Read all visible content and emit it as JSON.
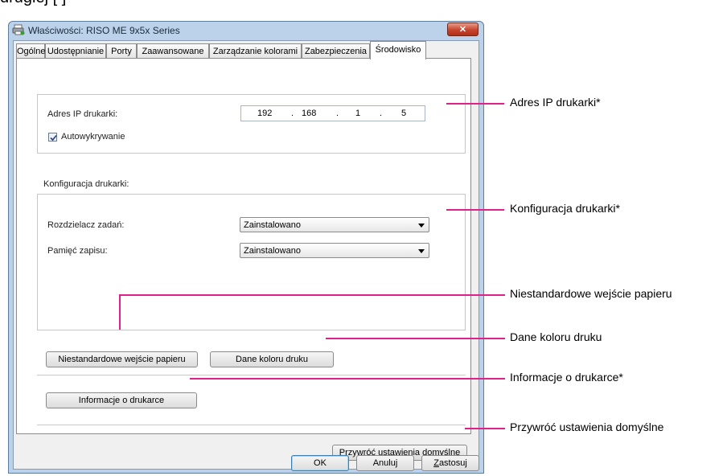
{
  "header_caption": "drugiej [ ]",
  "window": {
    "title": "Właściwości: RISO ME 9x5x Series",
    "close_label": "✕"
  },
  "tabs": [
    {
      "label": "Ogólne"
    },
    {
      "label": "Udostępnianie"
    },
    {
      "label": "Porty"
    },
    {
      "label": "Zaawansowane"
    },
    {
      "label": "Zarządzanie kolorami"
    },
    {
      "label": "Zabezpieczenia"
    },
    {
      "label": "Środowisko"
    }
  ],
  "ip_group": {
    "label": "Adres IP drukarki:",
    "octets": [
      "192",
      "168",
      "1",
      "5"
    ],
    "autodetect_label": "Autowykrywanie",
    "autodetect_checked": true
  },
  "config_group": {
    "heading": "Konfiguracja drukarki:",
    "job_separator_label": "Rozdzielacz zadań:",
    "job_separator_value": "Zainstalowano",
    "storage_label": "Pamięć zapisu:",
    "storage_value": "Zainstalowano"
  },
  "buttons": {
    "custom_paper": "Niestandardowe wejście papieru",
    "color_data": "Dane koloru druku",
    "printer_info": "Informacje o drukarce",
    "restore_defaults": "Przywróć ustawienia domyślne",
    "ok": "OK",
    "cancel": "Anuluj",
    "apply_prefix": "",
    "apply_underlined": "Z",
    "apply_rest": "astosuj"
  },
  "callouts": {
    "ip": "Adres IP drukarki*",
    "config": "Konfiguracja drukarki*",
    "custom_paper": "Niestandardowe wejście papieru",
    "color_data": "Dane koloru druku",
    "printer_info": "Informacje o drukarce*",
    "restore": "Przywróć ustawienia domyślne"
  },
  "colors": {
    "callout": "#e0218a",
    "window_frame": "#bcd2ea",
    "close_button": "#c8442c"
  }
}
